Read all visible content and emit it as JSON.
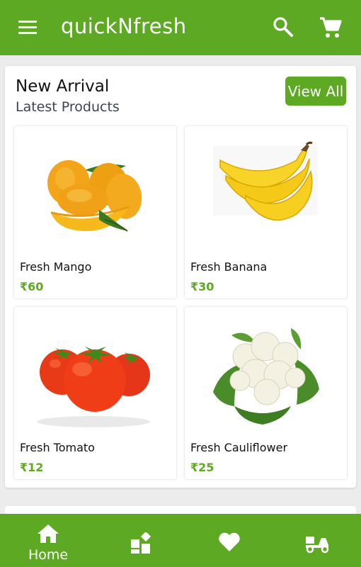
{
  "appbar": {
    "title": "quickNfresh",
    "icons": [
      "menu-icon",
      "search-icon",
      "cart-icon"
    ]
  },
  "section": {
    "heading": "New Arrival",
    "subheading": "Latest Products",
    "view_all_label": "View All"
  },
  "products": [
    {
      "name": "Fresh Mango",
      "price": "₹60"
    },
    {
      "name": "Fresh Banana",
      "price": "₹30"
    },
    {
      "name": "Fresh Tomato",
      "price": "₹12"
    },
    {
      "name": "Fresh Cauliflower",
      "price": "₹25"
    }
  ],
  "bottom_nav": {
    "items": [
      {
        "label": "Home",
        "icon": "home-icon",
        "active": true
      },
      {
        "label": "",
        "icon": "categories-icon"
      },
      {
        "label": "",
        "icon": "favorites-heart-icon"
      },
      {
        "label": "",
        "icon": "delivery-scooter-icon"
      }
    ]
  },
  "colors": {
    "primary": "#5da924",
    "background": "#ececec",
    "subheading": "#3d4257"
  }
}
